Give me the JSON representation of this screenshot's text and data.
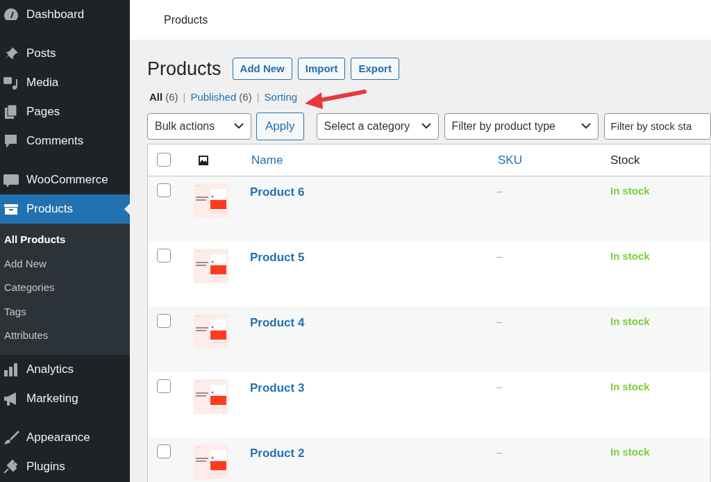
{
  "sidebar": {
    "items": [
      {
        "label": "Dashboard",
        "selected": false
      },
      {
        "label": "Posts",
        "selected": false
      },
      {
        "label": "Media",
        "selected": false
      },
      {
        "label": "Pages",
        "selected": false
      },
      {
        "label": "Comments",
        "selected": false
      },
      {
        "label": "WooCommerce",
        "selected": false
      },
      {
        "label": "Products",
        "selected": true,
        "children": [
          {
            "label": "All Products",
            "selected": true
          },
          {
            "label": "Add New",
            "selected": false
          },
          {
            "label": "Categories",
            "selected": false
          },
          {
            "label": "Tags",
            "selected": false
          },
          {
            "label": "Attributes",
            "selected": false
          }
        ]
      },
      {
        "label": "Analytics",
        "selected": false
      },
      {
        "label": "Marketing",
        "selected": false
      },
      {
        "label": "Appearance",
        "selected": false
      },
      {
        "label": "Plugins",
        "selected": false
      }
    ]
  },
  "header": {
    "title": "Products"
  },
  "page": {
    "title": "Products",
    "buttons": [
      "Add New",
      "Import",
      "Export"
    ]
  },
  "views": {
    "separator": "|",
    "items": [
      {
        "label": "All",
        "count": "(6)",
        "selected": true
      },
      {
        "label": "Published",
        "count": "(6)",
        "selected": false
      },
      {
        "label": "Sorting",
        "selected": false
      }
    ]
  },
  "filters": {
    "bulk_action": "Bulk actions",
    "apply": "Apply",
    "selects": [
      "Select a category",
      "Filter by product type",
      "Filter by stock sta"
    ]
  },
  "table": {
    "select_all": {
      "checked": false
    },
    "columns": [
      "Name",
      "SKU",
      "Stock"
    ],
    "rows": [
      {
        "checked": false,
        "name": "Product 6",
        "sku": "–",
        "stock": "In stock"
      },
      {
        "checked": false,
        "name": "Product 5",
        "sku": "–",
        "stock": "In stock"
      },
      {
        "checked": false,
        "name": "Product 4",
        "sku": "–",
        "stock": "In stock"
      },
      {
        "checked": false,
        "name": "Product 3",
        "sku": "–",
        "stock": "In stock"
      },
      {
        "checked": false,
        "name": "Product 2",
        "sku": "–",
        "stock": "In stock"
      }
    ]
  }
}
